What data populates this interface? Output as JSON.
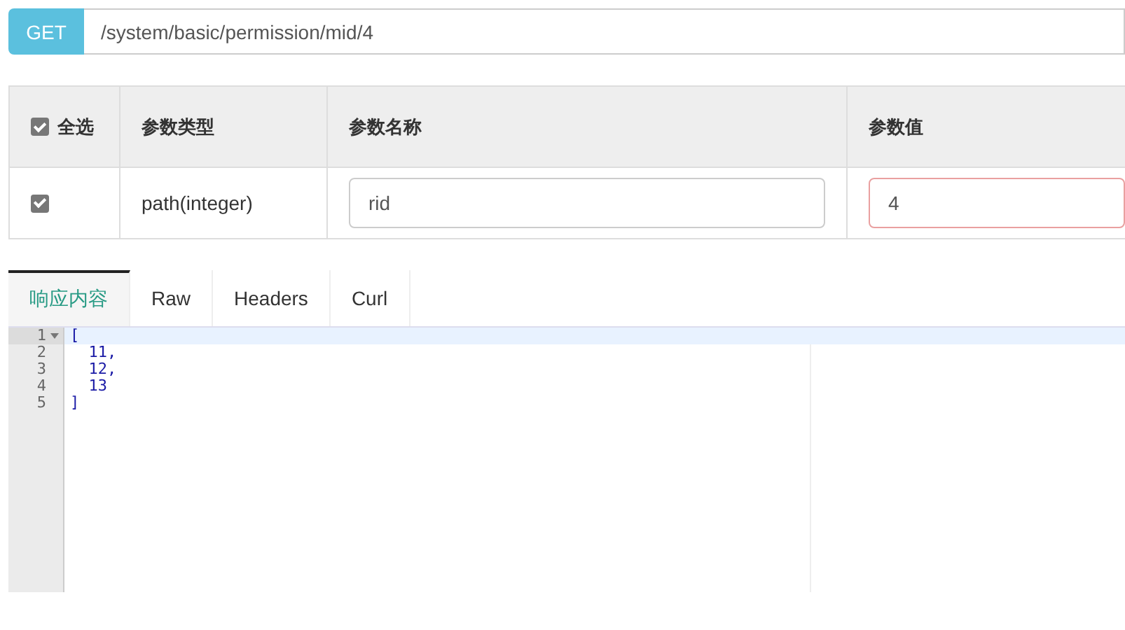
{
  "request": {
    "method": "GET",
    "url": "/system/basic/permission/mid/4"
  },
  "params": {
    "select_all": {
      "label": "全选",
      "checked": true
    },
    "columns": [
      "参数类型",
      "参数名称",
      "参数值"
    ],
    "rows": [
      {
        "checked": true,
        "type": "path(integer)",
        "name": "rid",
        "value": "4",
        "invalid": true
      }
    ]
  },
  "tabs": [
    {
      "label": "响应内容",
      "selected": true
    },
    {
      "label": "Raw",
      "selected": false
    },
    {
      "label": "Headers",
      "selected": false
    },
    {
      "label": "Curl",
      "selected": false
    }
  ],
  "editor": {
    "lines": [
      {
        "number": "1",
        "text": "[",
        "active": true,
        "foldable": true
      },
      {
        "number": "2",
        "text": "  11,",
        "active": false,
        "foldable": false
      },
      {
        "number": "3",
        "text": "  12,",
        "active": false,
        "foldable": false
      },
      {
        "number": "4",
        "text": "  13",
        "active": false,
        "foldable": false
      },
      {
        "number": "5",
        "text": "]",
        "active": false,
        "foldable": false
      }
    ]
  }
}
